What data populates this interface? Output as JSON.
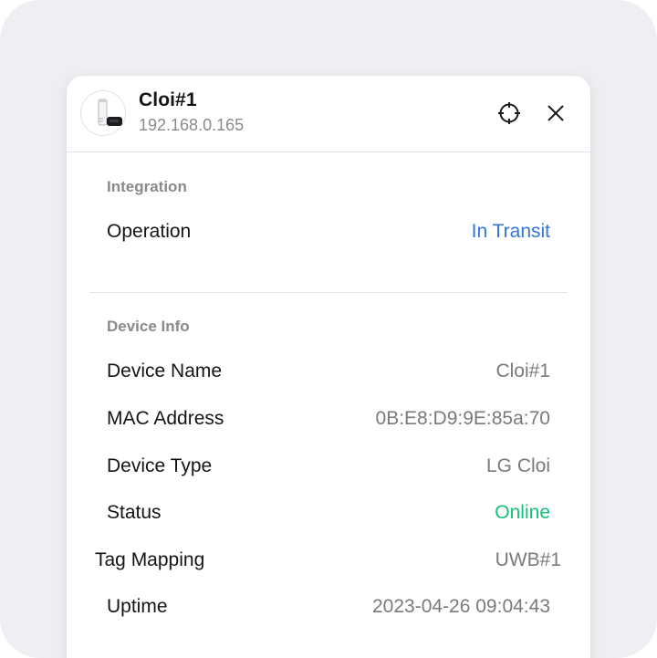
{
  "device": {
    "name": "Cloi#1",
    "ip": "192.168.0.165",
    "avatar_icon": "robot-device-icon"
  },
  "header_actions": {
    "locate_icon": "crosshair-icon",
    "close_icon": "close-icon"
  },
  "integration": {
    "title": "Integration",
    "operation_label": "Operation",
    "operation_value": "In Transit",
    "operation_color": "#2f74e0"
  },
  "device_info": {
    "title": "Device Info",
    "rows": [
      {
        "label": "Device Name",
        "value": "Cloi#1"
      },
      {
        "label": "MAC Address",
        "value": "0B:E8:D9:9E:85a:70"
      },
      {
        "label": "Device Type",
        "value": "LG Cloi"
      },
      {
        "label": "Status",
        "value": "Online"
      },
      {
        "label": "Tag Mapping",
        "value": "UWB#1"
      },
      {
        "label": "Uptime",
        "value": "2023-04-26 09:04:43"
      }
    ],
    "status_color": "#13c07a"
  }
}
